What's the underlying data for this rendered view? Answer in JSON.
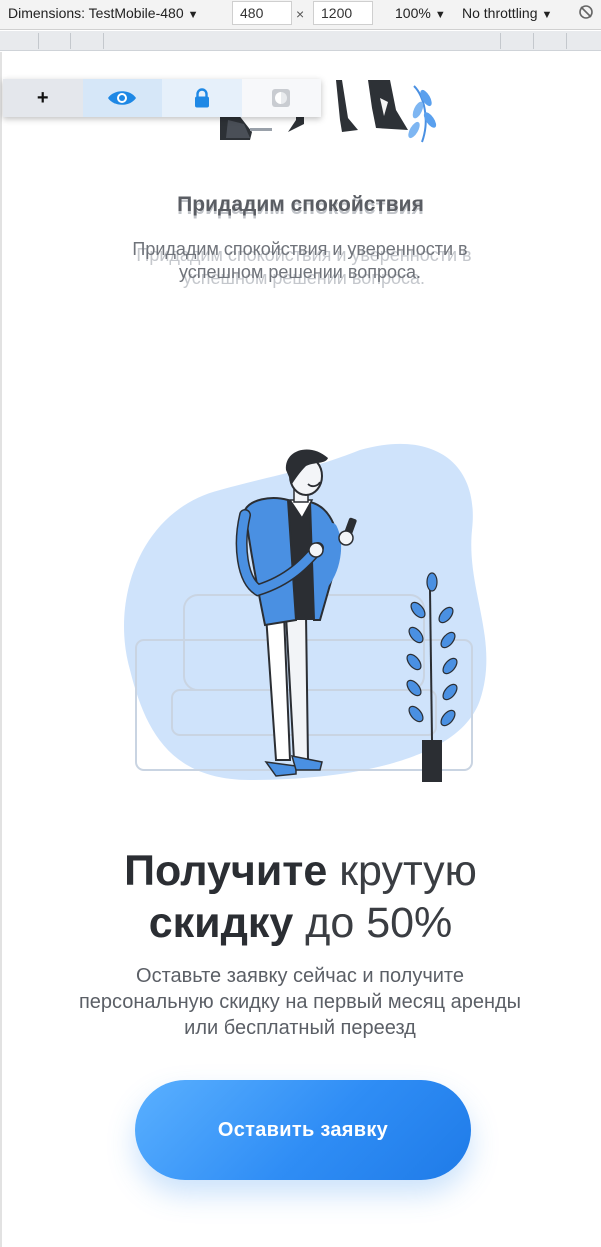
{
  "devtools": {
    "dimensions_label": "Dimensions: TestMobile-480",
    "width_value": "480",
    "height_value": "1200",
    "times_sign": "×",
    "zoom_label": "100%",
    "throttling_label": "No throttling"
  },
  "a11y_toolbar": {
    "plus_label": "+",
    "icons": [
      "plus-icon",
      "eye-icon",
      "lock-icon",
      "contrast-icon"
    ]
  },
  "section_calm": {
    "title": "Придадим спокойствия",
    "description": "Придадим спокойствия и уверенности в успешном решении вопроса."
  },
  "promo": {
    "headline_bold_1": "Получите",
    "headline_light_1": "крутую",
    "headline_bold_2": "скидку",
    "headline_light_2": "до 50%",
    "subtext": "Оставьте заявку сейчас и получите персональную скидку на первый месяц аренды или бесплатный переезд",
    "cta_label": "Оставить заявку"
  },
  "colors": {
    "accent": "#2f8df5",
    "illustration_bg": "#cfe3fb",
    "jacket": "#4a90e2"
  }
}
